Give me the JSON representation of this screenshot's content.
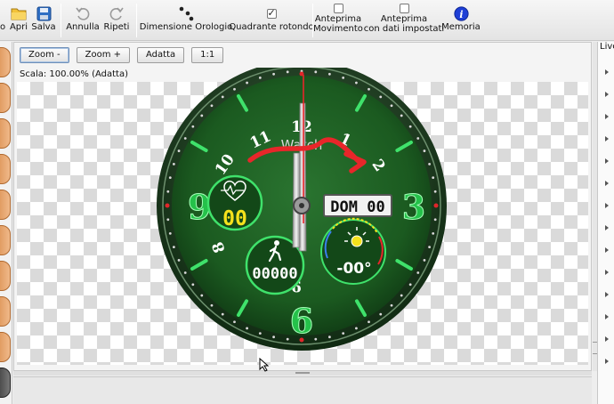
{
  "toolbar": {
    "items": [
      {
        "label": "o"
      },
      {
        "label": "Apri"
      },
      {
        "label": "Salva"
      },
      {
        "label": "Annulla"
      },
      {
        "label": "Ripeti"
      },
      {
        "label": "Dimensione Orologio"
      },
      {
        "label": "Quadrante rotondo",
        "checked": true
      },
      {
        "label": "Anteprima\nMovimento",
        "checked": false
      },
      {
        "label": "Anteprima\ncon dati impostati",
        "checked": false
      },
      {
        "label": "Memoria"
      }
    ]
  },
  "zoom": {
    "buttons": [
      "Zoom -",
      "Zoom +",
      "Adatta",
      "1:1"
    ],
    "scale_text": "Scala:  100.00%  (Adatta)"
  },
  "right_panel": {
    "title": "Live"
  },
  "watch": {
    "numerals": {
      "n3": "3",
      "n6": "6",
      "n9": "9",
      "n8": "8",
      "n9b": "9",
      "n10": "10",
      "n11": "11",
      "n12": "12",
      "n1": "1",
      "n2": "2"
    },
    "brand": "Watch",
    "heart_value": "00",
    "date_text": "DOM 00",
    "steps_value": "00000",
    "weather_value": "-00°"
  },
  "colors": {
    "dial": "#1d5a22",
    "accent_green": "#3fe26b",
    "yellow": "#f4e21c",
    "annotation_red": "#e8262a"
  }
}
